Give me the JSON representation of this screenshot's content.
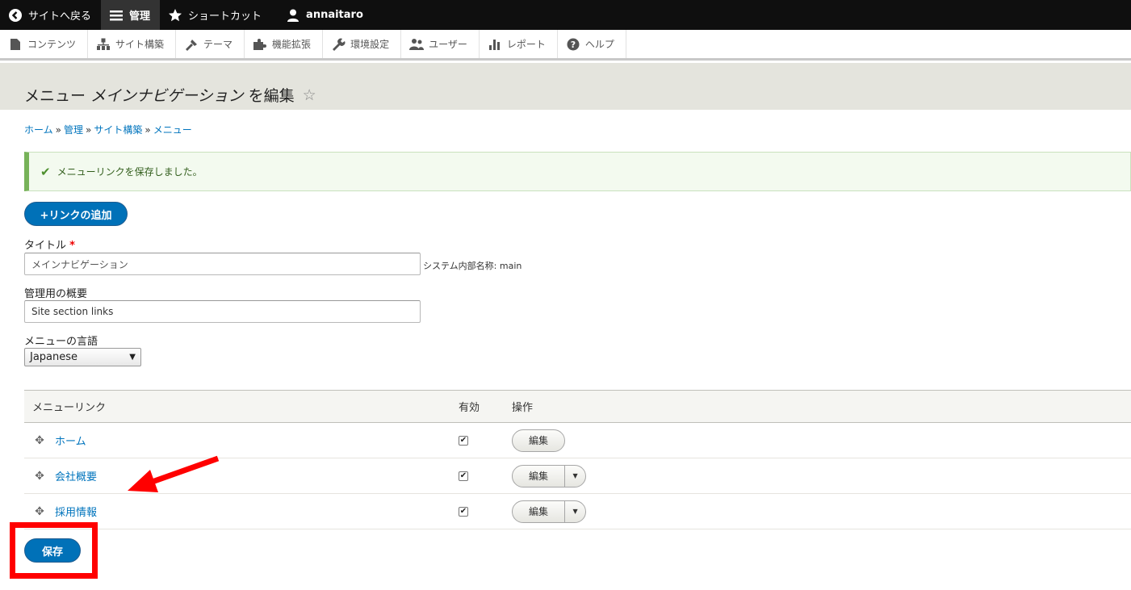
{
  "toolbar": {
    "back_to_site": "サイトへ戻る",
    "manage": "管理",
    "shortcuts": "ショートカット",
    "user": "annaitaro"
  },
  "tray": {
    "items": [
      "コンテンツ",
      "サイト構築",
      "テーマ",
      "機能拡張",
      "環境設定",
      "ユーザー",
      "レポート",
      "ヘルプ"
    ]
  },
  "page": {
    "title_prefix": "メニュー",
    "title_menu": "メインナビゲーション",
    "title_suffix": "を編集"
  },
  "breadcrumb": {
    "items": [
      "ホーム",
      "管理",
      "サイト構築",
      "メニュー"
    ],
    "separator": "»"
  },
  "status": {
    "message": "メニューリンクを保存しました。"
  },
  "actions": {
    "add_link": "+リンクの追加",
    "save": "保存"
  },
  "form": {
    "title_label": "タイトル",
    "required_mark": "*",
    "title_value": "メインナビゲーション",
    "machine_name": "システム内部名称: main",
    "description_label": "管理用の概要",
    "description_value": "Site section links",
    "language_label": "メニューの言語",
    "language_value": "Japanese"
  },
  "table": {
    "headers": {
      "link": "メニューリンク",
      "enabled": "有効",
      "operations": "操作"
    },
    "rows": [
      {
        "title": "ホーム",
        "enabled": "✔",
        "edit": "編集"
      },
      {
        "title": "会社概要",
        "enabled": "✔",
        "edit": "編集"
      },
      {
        "title": "採用情報",
        "enabled": "✔",
        "edit": "編集"
      }
    ]
  },
  "annotations": {
    "color": "#ff0000"
  }
}
